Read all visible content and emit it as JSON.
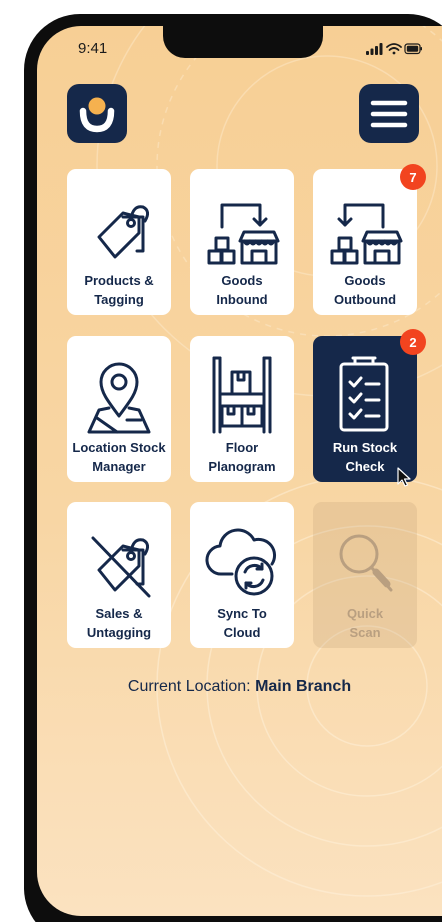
{
  "status_bar": {
    "time": "9:41"
  },
  "header": {
    "logo_icon": "brand-smile-logo-icon",
    "menu_icon": "hamburger-menu-icon"
  },
  "tiles": [
    {
      "label": "Products &\nTagging",
      "icon": "price-tags-icon"
    },
    {
      "label": "Goods\nInbound",
      "icon": "goods-inbound-icon"
    },
    {
      "label": "Goods\nOutbound",
      "icon": "goods-outbound-icon",
      "badge": "7"
    },
    {
      "label": "Location Stock\nManager",
      "icon": "map-pin-icon"
    },
    {
      "label": "Floor\nPlanogram",
      "icon": "shelf-icon"
    },
    {
      "label": "Run Stock\nCheck",
      "icon": "checklist-clipboard-icon",
      "badge": "2",
      "state": "active"
    },
    {
      "label": "Sales &\nUntagging",
      "icon": "untag-icon"
    },
    {
      "label": "Sync To\nCloud",
      "icon": "cloud-sync-icon"
    },
    {
      "label": "Quick\nScan",
      "icon": "magnifier-icon",
      "state": "disabled"
    }
  ],
  "footer": {
    "location_label": "Current Location: ",
    "location_value": "Main Branch"
  },
  "colors": {
    "navy": "#15284a",
    "badge": "#f2441f",
    "background": "#f7cf95"
  }
}
